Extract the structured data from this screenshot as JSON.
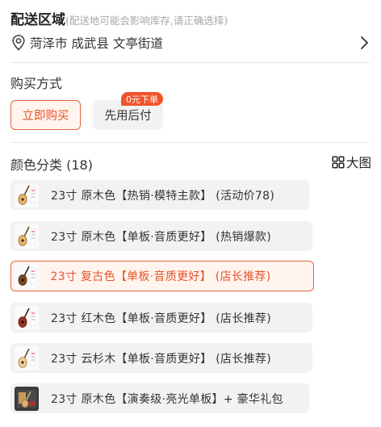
{
  "delivery": {
    "title": "配送区域",
    "note": "(配送地可能会影响库存,请正确选择)",
    "address": "菏泽市 成武县 文亭街道",
    "pin_icon": "location-pin-icon",
    "chevron_icon": "chevron-right-icon"
  },
  "purchase": {
    "title": "购买方式",
    "buy_now_label": "立即购买",
    "pay_later_label": "先用后付",
    "pay_later_badge": "0元下单"
  },
  "colors": {
    "title": "颜色分类 (18)",
    "big_view_label": "大图",
    "big_view_icon": "grid-view-icon",
    "accent": "#e6532a",
    "options": [
      {
        "label": "23寸 原木色【热销·模特主款】 (活动价78)",
        "thumb": "guitar-natural-icon",
        "selected": false
      },
      {
        "label": "23寸 原木色【单板·音质更好】 (热销爆款)",
        "thumb": "guitar-natural-icon",
        "selected": false
      },
      {
        "label": "23寸 复古色【单板·音质更好】 (店长推荐)",
        "thumb": "guitar-vintage-icon",
        "selected": true
      },
      {
        "label": "23寸 红木色【单板·音质更好】 (店长推荐)",
        "thumb": "guitar-red-icon",
        "selected": false
      },
      {
        "label": "23寸 云杉木【单板·音质更好】 (店长推荐)",
        "thumb": "guitar-spruce-icon",
        "selected": false
      },
      {
        "label": "23寸 原木色【演奏级·亮光单板】+ 豪华礼包",
        "thumb": "guitar-gift-pack-icon",
        "selected": false
      }
    ]
  }
}
